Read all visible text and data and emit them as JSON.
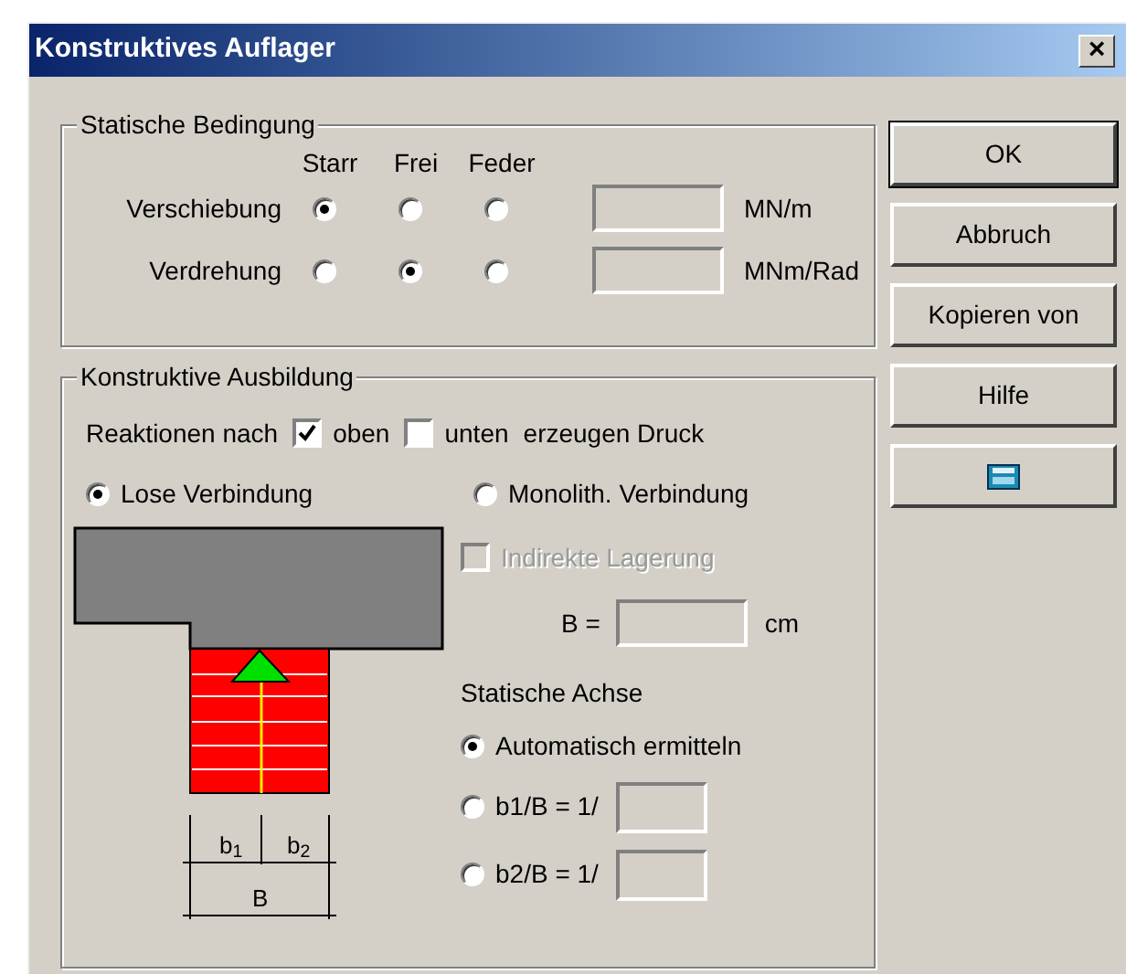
{
  "window": {
    "title": "Konstruktives Auflager",
    "close": "×"
  },
  "static_condition": {
    "title": "Statische Bedingung",
    "columns": [
      "Starr",
      "Frei",
      "Feder"
    ],
    "rows": [
      {
        "label": "Verschiebung",
        "options": [
          {
            "selected": true
          },
          {
            "selected": false
          },
          {
            "selected": false
          }
        ],
        "unit": "MN/m"
      },
      {
        "label": "Verdrehung",
        "options": [
          {
            "selected": false
          },
          {
            "selected": true
          },
          {
            "selected": false
          }
        ],
        "unit": "MNm/Rad"
      }
    ]
  },
  "design": {
    "title": "Konstruktive Ausbildung",
    "reactions_label": "Reaktionen nach",
    "checks": [
      {
        "label": "oben",
        "checked": true
      },
      {
        "label": "unten",
        "checked": false
      }
    ],
    "reactions_suffix": "erzeugen Druck",
    "connection": [
      {
        "label": "Lose Verbindung",
        "selected": true
      },
      {
        "label": "Monolith. Verbindung",
        "selected": false
      }
    ],
    "indirect": {
      "label": "Indirekte Lagerung",
      "checked": false,
      "disabled": true
    },
    "b_label": "B =",
    "b_unit": "cm",
    "axis_title": "Statische Achse",
    "axis_options": [
      {
        "label": "Automatisch ermitteln",
        "selected": true,
        "kind": "plain"
      },
      {
        "label": "b1/B = 1/",
        "selected": false,
        "kind": "input"
      },
      {
        "label": "b2/B = 1/",
        "selected": false,
        "kind": "input"
      }
    ],
    "diagram": {
      "labels": [
        "b$_{1}$",
        "b$_{2}$",
        "B"
      ]
    }
  },
  "buttons": [
    {
      "label": "OK",
      "kind": "default"
    },
    {
      "label": "Abbruch",
      "kind": "text"
    },
    {
      "label": "Kopieren von",
      "kind": "text"
    },
    {
      "label": "Hilfe",
      "kind": "text"
    },
    {
      "kind": "calculator"
    }
  ]
}
